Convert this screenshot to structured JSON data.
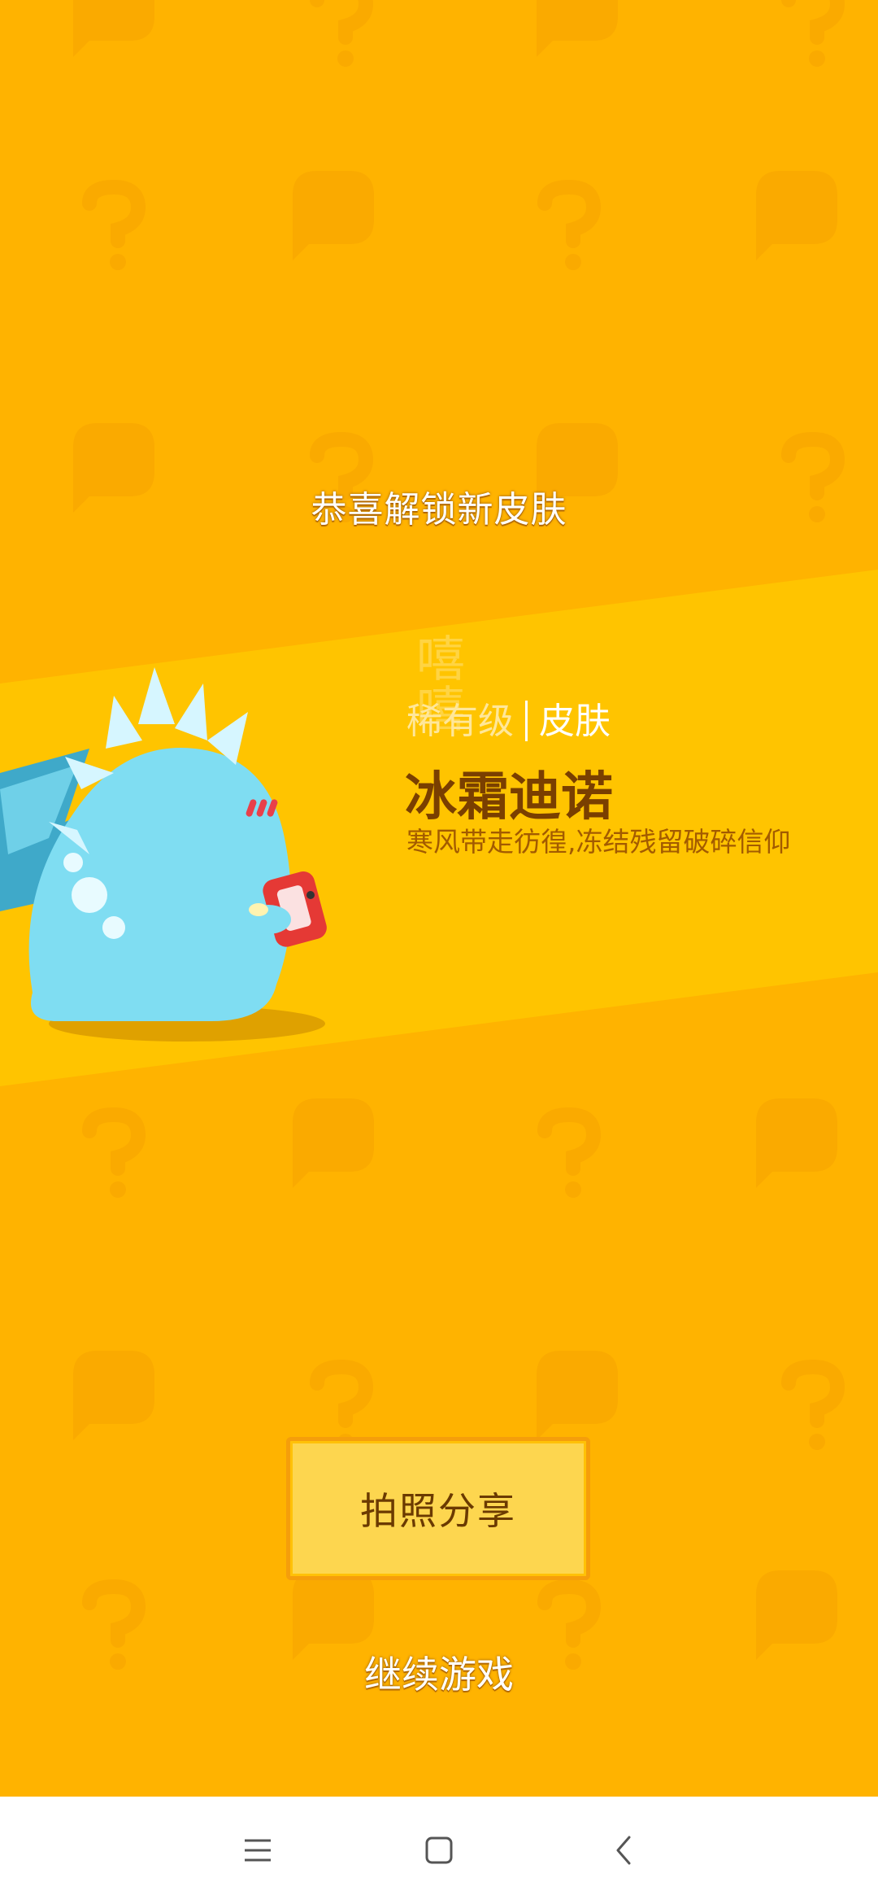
{
  "screen": {
    "congrats_title": "恭喜解锁新皮肤",
    "decor_text": "嘻嘻"
  },
  "skin": {
    "rarity": "稀有级",
    "type": "皮肤",
    "name": "冰霜迪诺",
    "description": "寒风带走彷徨,冻结残留破碎信仰"
  },
  "actions": {
    "share_label": "拍照分享",
    "continue_label": "继续游戏"
  },
  "navbar": {
    "recents_icon": "menu-icon",
    "home_icon": "home-square-icon",
    "back_icon": "back-chevron-icon"
  },
  "colors": {
    "background": "#FFB300",
    "band": "#FFC400",
    "button_fill": "#FDD64F",
    "button_border": "#F59E0B",
    "skin_name": "#7A3F00"
  }
}
